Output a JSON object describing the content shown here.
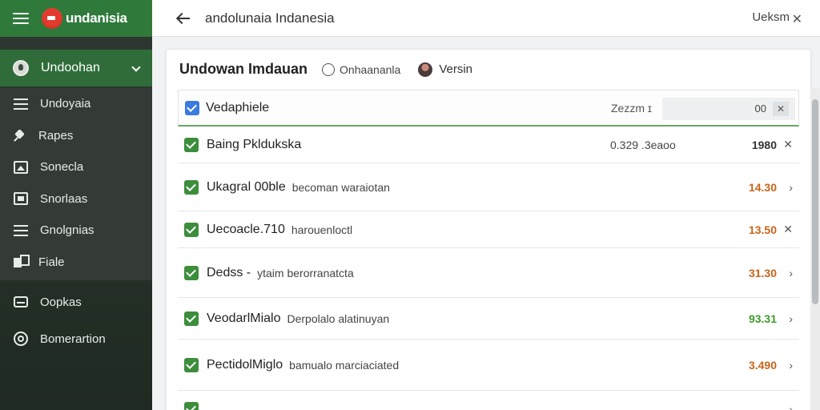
{
  "app": {
    "brand": "undanisia",
    "sidebar_header": "Undoohan",
    "sidebar_items": [
      {
        "icon": "list-icon",
        "label": "Undoyaia"
      },
      {
        "icon": "pin-icon",
        "label": "Rapes"
      },
      {
        "icon": "photo-icon",
        "label": "Sonecla"
      },
      {
        "icon": "box-icon",
        "label": "Snorlaas"
      },
      {
        "icon": "list-icon",
        "label": "Gnolgnias"
      },
      {
        "icon": "file-icon",
        "label": "Fiale"
      }
    ],
    "sidebar_bottom": [
      {
        "icon": "drive-icon",
        "label": "Oopkas"
      },
      {
        "icon": "target-icon",
        "label": "Bomerartion"
      }
    ]
  },
  "topbar": {
    "title": "andolunaia Indanesia",
    "right_label": "Ueksm",
    "close": "✕"
  },
  "panel": {
    "title": "Undowan Imdauan",
    "radio_label": "Onhaananla",
    "version_label": "Versin"
  },
  "table": {
    "header": {
      "label": "Vedaphiele",
      "size_label": "Zezzm ɪ",
      "filter_value": "00",
      "filter_clear": "✕"
    },
    "rows": [
      {
        "name": "Baing Pkldukska",
        "desc": "",
        "size": "0.329 .3eaoo",
        "value": "1980",
        "value_color": "#333333",
        "action": "✕"
      },
      {
        "name": "Ukagral 00ble",
        "desc": "becoman waraiotan",
        "size": "",
        "value": "14.30",
        "value_color": "#c7641a",
        "action": "›"
      },
      {
        "name": "Uecoacle.710",
        "desc": "harouenloctl",
        "size": "",
        "value": "13.50",
        "value_color": "#c7641a",
        "action": "✕"
      },
      {
        "name": "Dedss -",
        "desc": "ytaim berorranatcta",
        "size": "",
        "value": "31.30",
        "value_color": "#c7641a",
        "action": "›"
      },
      {
        "name": "VeodarlMialo",
        "desc": "Derpolalo alatinuyan",
        "size": "",
        "value": "93.31",
        "value_color": "#3f9a2a",
        "action": "›"
      },
      {
        "name": "PectidolMiglo",
        "desc": "bamualo marciaciated",
        "size": "",
        "value": "3.490",
        "value_color": "#c7641a",
        "action": "›"
      },
      {
        "name": "",
        "desc": "",
        "size": "",
        "value": "",
        "value_color": "#3f9a2a",
        "action": "›"
      }
    ]
  }
}
